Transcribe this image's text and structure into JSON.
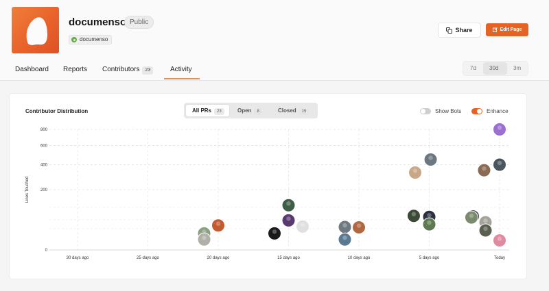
{
  "repo": {
    "name": "documenso",
    "visibility": "Public",
    "org": "documenso",
    "logo_icon": "documenso-logo-icon"
  },
  "actions": {
    "share_label": "Share",
    "edit_label": "Edit Page"
  },
  "tabs": [
    {
      "label": "Dashboard"
    },
    {
      "label": "Reports"
    },
    {
      "label": "Contributors",
      "count": "23"
    },
    {
      "label": "Activity",
      "active": true
    }
  ],
  "range": {
    "options": [
      "7d",
      "30d",
      "3m"
    ],
    "selected": "30d"
  },
  "card": {
    "title": "Contributor Distribution",
    "filters": [
      {
        "label": "All PRs",
        "count": "23",
        "active": true
      },
      {
        "label": "Open",
        "count": "8"
      },
      {
        "label": "Closed",
        "count": "15"
      }
    ],
    "toggles": [
      {
        "label": "Show Bots",
        "on": false
      },
      {
        "label": "Enhance",
        "on": true
      }
    ]
  },
  "colors": {
    "accent": "#e56425",
    "toggle_off": "#cfcfcf"
  },
  "chart_data": {
    "type": "scatter",
    "ylabel": "Lines Touched",
    "y_ticks": [
      "800",
      "600",
      "400",
      "200",
      "0"
    ],
    "x_ticks": [
      "30 days ago",
      "25 days ago",
      "20 days ago",
      "15 days ago",
      "10 days ago",
      "5 days ago",
      "Today"
    ],
    "x_axis_days_ago": [
      30,
      25,
      20,
      15,
      10,
      5,
      0
    ],
    "xlim": [
      32,
      0
    ],
    "points": [
      {
        "days_ago": 0.0,
        "lines": 800,
        "avatar": "#9b6fd1"
      },
      {
        "days_ago": 0.0,
        "lines": 400,
        "avatar": "#4a5560"
      },
      {
        "days_ago": 1.1,
        "lines": 350,
        "avatar": "#8a6a52"
      },
      {
        "days_ago": 4.9,
        "lines": 450,
        "avatar": "#6b7781"
      },
      {
        "days_ago": 6.0,
        "lines": 330,
        "avatar": "#c9a887"
      },
      {
        "days_ago": 15.0,
        "lines": 110,
        "avatar": "#3f5e48"
      },
      {
        "days_ago": 1.9,
        "lines": 62,
        "avatar": "#3f4858"
      },
      {
        "days_ago": 5.0,
        "lines": 60,
        "avatar": "#2b3140"
      },
      {
        "days_ago": 6.1,
        "lines": 64,
        "avatar": "#3a4a36"
      },
      {
        "days_ago": 2.0,
        "lines": 58,
        "avatar": "#7a8a6c"
      },
      {
        "days_ago": 1.0,
        "lines": 42,
        "avatar": "#a6a29a"
      },
      {
        "days_ago": 15.0,
        "lines": 48,
        "avatar": "#5a3a6e"
      },
      {
        "days_ago": 5.0,
        "lines": 36,
        "avatar": "#5f7a52"
      },
      {
        "days_ago": 14.0,
        "lines": 30,
        "avatar": "#e0e0e0"
      },
      {
        "days_ago": 20.0,
        "lines": 33,
        "avatar": "#c45a30"
      },
      {
        "days_ago": 11.0,
        "lines": 29,
        "avatar": "#6f7a80"
      },
      {
        "days_ago": 10.0,
        "lines": 28,
        "avatar": "#b06840"
      },
      {
        "days_ago": 1.0,
        "lines": 21,
        "avatar": "#5a6050"
      },
      {
        "days_ago": 21.0,
        "lines": 15,
        "avatar": "#8aa080"
      },
      {
        "days_ago": 16.0,
        "lines": 15,
        "avatar": "#1a1a1a"
      },
      {
        "days_ago": 21.0,
        "lines": 6,
        "avatar": "#b0b0a8"
      },
      {
        "days_ago": 11.0,
        "lines": 6,
        "avatar": "#5a7a92"
      },
      {
        "days_ago": 0.0,
        "lines": 5,
        "avatar": "#e08aa0"
      }
    ]
  }
}
